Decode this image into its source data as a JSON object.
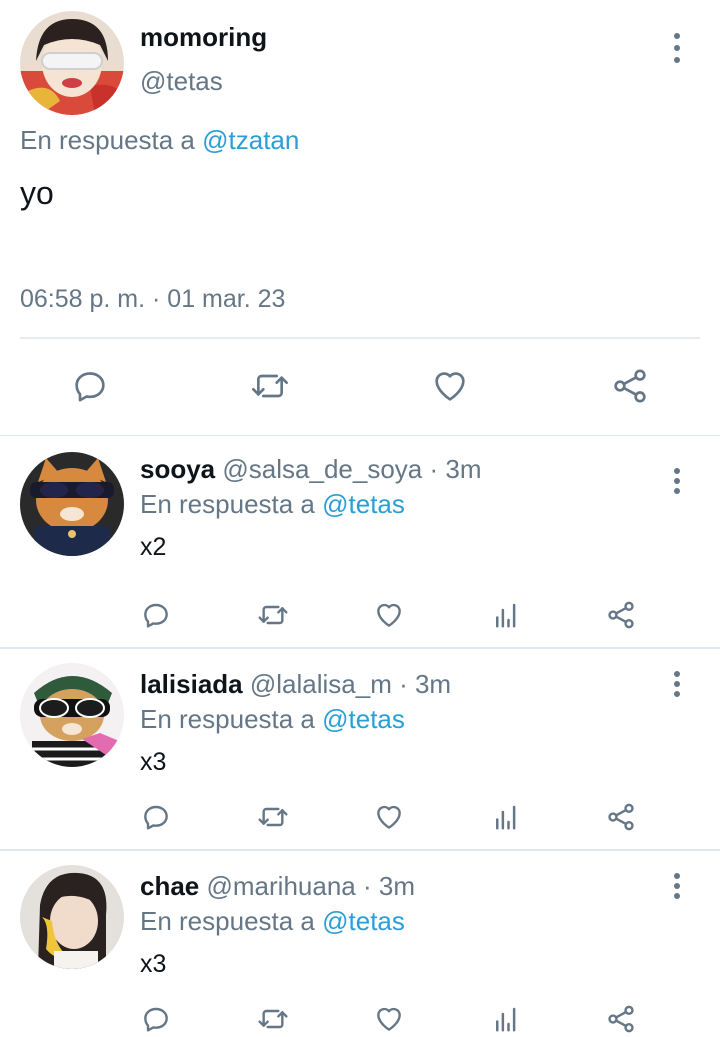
{
  "main_tweet": {
    "name": "momoring",
    "handle": "@tetas",
    "reply_prefix": "En respuesta a",
    "reply_to": "@tzatan",
    "text": "yo",
    "timestamp": "06:58 p. m. · 01 mar. 23",
    "actions": [
      "reply-icon",
      "retweet-icon",
      "like-icon",
      "share-icon"
    ]
  },
  "replies": [
    {
      "name": "sooya",
      "handle": "@salsa_de_soya",
      "time": "· 3m",
      "reply_prefix": "En respuesta a",
      "reply_to": "@tetas",
      "text": "x2"
    },
    {
      "name": "lalisiada",
      "handle": "@lalalisa_m",
      "time": "· 3m",
      "reply_prefix": "En respuesta a",
      "reply_to": "@tetas",
      "text": "x3"
    },
    {
      "name": "chae",
      "handle": "@marihuana",
      "time": "· 3m",
      "reply_prefix": "En respuesta a",
      "reply_to": "@tetas",
      "text": "x3"
    }
  ],
  "colors": {
    "text": "#0f1419",
    "secondary": "#657786",
    "link": "#2a9fd6",
    "divider": "#e1e8ed"
  }
}
